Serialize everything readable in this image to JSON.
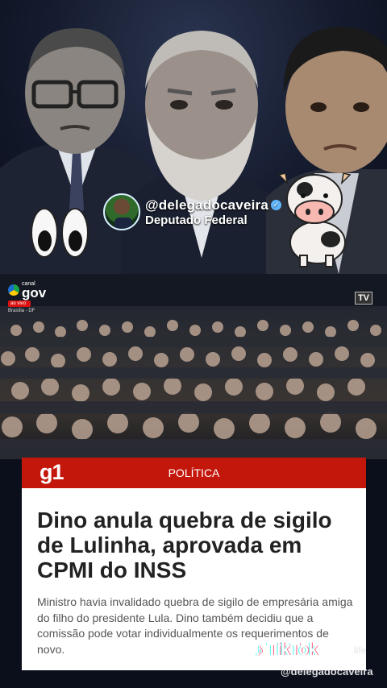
{
  "creator": {
    "handle": "@delegadocaveira",
    "title": "Deputado Federal"
  },
  "broadcast": {
    "canal_label": "canal",
    "canal_name": "gov",
    "live_label": "ao vivo",
    "location": "Brasília - DF",
    "tv_badge": "TV"
  },
  "news": {
    "source": "g1",
    "section": "POLÍTICA",
    "headline": "Dino anula quebra de sigilo de Lulinha, aprovada em CPMI do INSS",
    "summary": "Ministro havia invalidado quebra de sigilo de empresária amiga do filho do presidente Lula. Dino também decidiu que a comissão pode votar individualmente os requerimentos de novo."
  },
  "watermark": {
    "app": "TikTok",
    "extra": "life",
    "handle": "@delegadocaveira"
  },
  "colors": {
    "g1_red": "#c4170c",
    "background": "#0b0f1c"
  }
}
